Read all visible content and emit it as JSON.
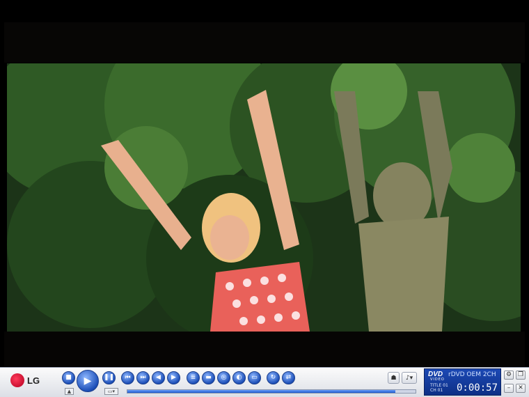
{
  "player": {
    "brand": "LG",
    "lcd": {
      "format": "DVD",
      "format_sub": "VIDEO",
      "mode": "rDVD OEM 2CH",
      "title_label": "TITLE 01",
      "chapter_label": "CH 01",
      "time": "0:00:57"
    },
    "progress_fraction": 0.93
  },
  "icons": {
    "stop": "stop-icon",
    "play": "play-icon",
    "pause": "pause-icon",
    "prev": "skip-back-icon",
    "next": "skip-forward-icon",
    "rewind": "rewind-icon",
    "forward": "fast-forward-icon",
    "menu": "menu-icon",
    "subtitle": "subtitle-icon",
    "audio": "audio-icon",
    "angle": "angle-icon",
    "zoom": "zoom-icon",
    "repeat": "repeat-icon",
    "ab": "ab-repeat-icon",
    "eject": "eject-icon",
    "volume": "volume-icon"
  },
  "colors": {
    "accent": "#1d4fb8",
    "lcd": "#1c49b4",
    "brand": "#c4002a"
  }
}
